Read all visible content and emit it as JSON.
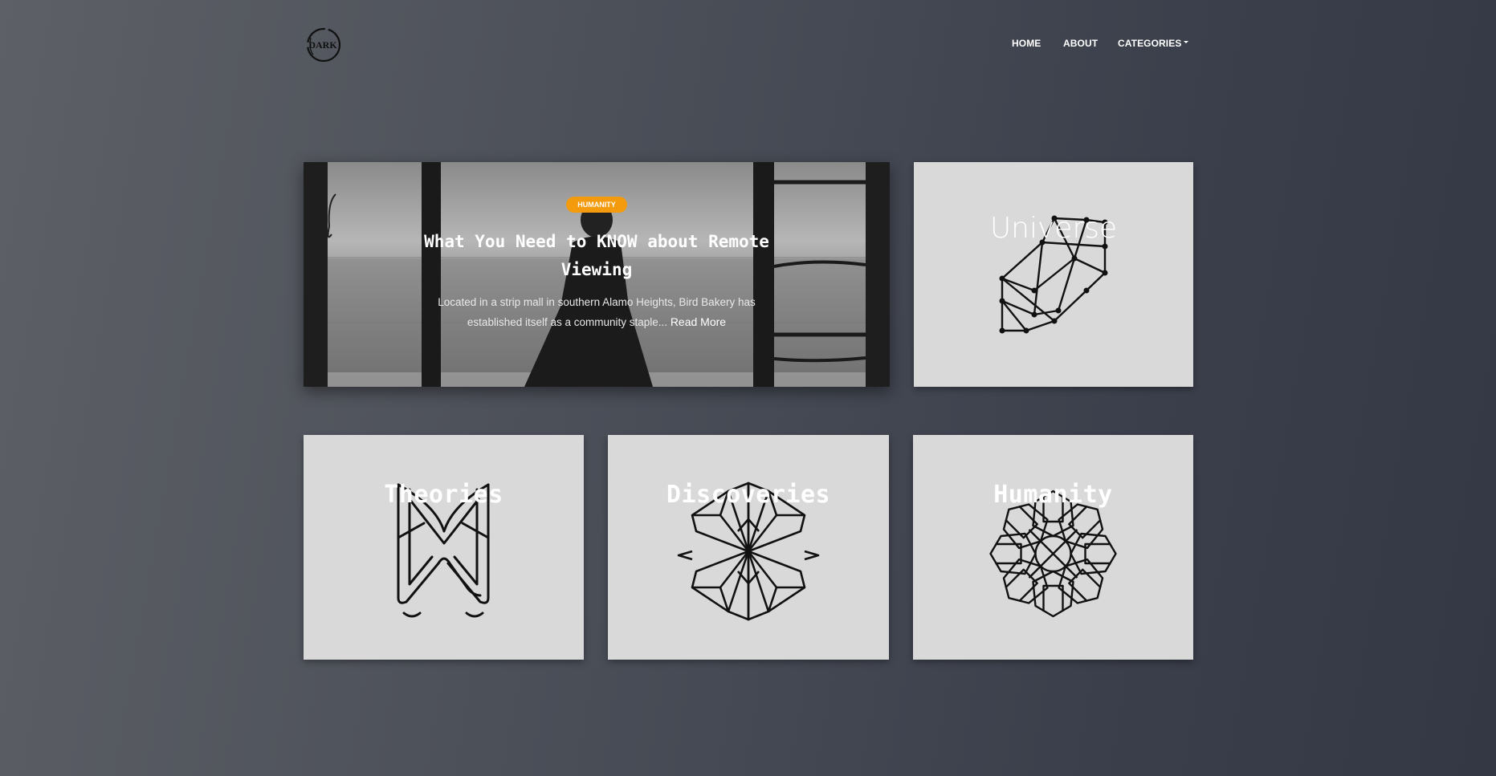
{
  "site": {
    "logo_text": "DARK"
  },
  "nav": {
    "items": [
      {
        "label": "HOME"
      },
      {
        "label": "ABOUT"
      },
      {
        "label": "CATEGORIES"
      }
    ]
  },
  "featured": {
    "category": "HUMANITY",
    "title": "What You Need to KNOW about Remote Viewing",
    "excerpt": "Located in a strip mall in southern Alamo Heights, Bird Bakery has established itself as a community staple...",
    "read_more": "Read More",
    "badge_color": "#f39a0d"
  },
  "categories": [
    {
      "title": "Universe",
      "icon": "constellation-icon"
    },
    {
      "title": "Theories",
      "icon": "w-knot-icon"
    },
    {
      "title": "Discoveries",
      "icon": "geometric-flower-icon"
    },
    {
      "title": "Humanity",
      "icon": "rosette-icon"
    }
  ],
  "colors": {
    "card_bg": "#d9d9d9",
    "icon_stroke": "#111111",
    "page_gradient_start": "#5d6066",
    "page_gradient_end": "#343844"
  }
}
